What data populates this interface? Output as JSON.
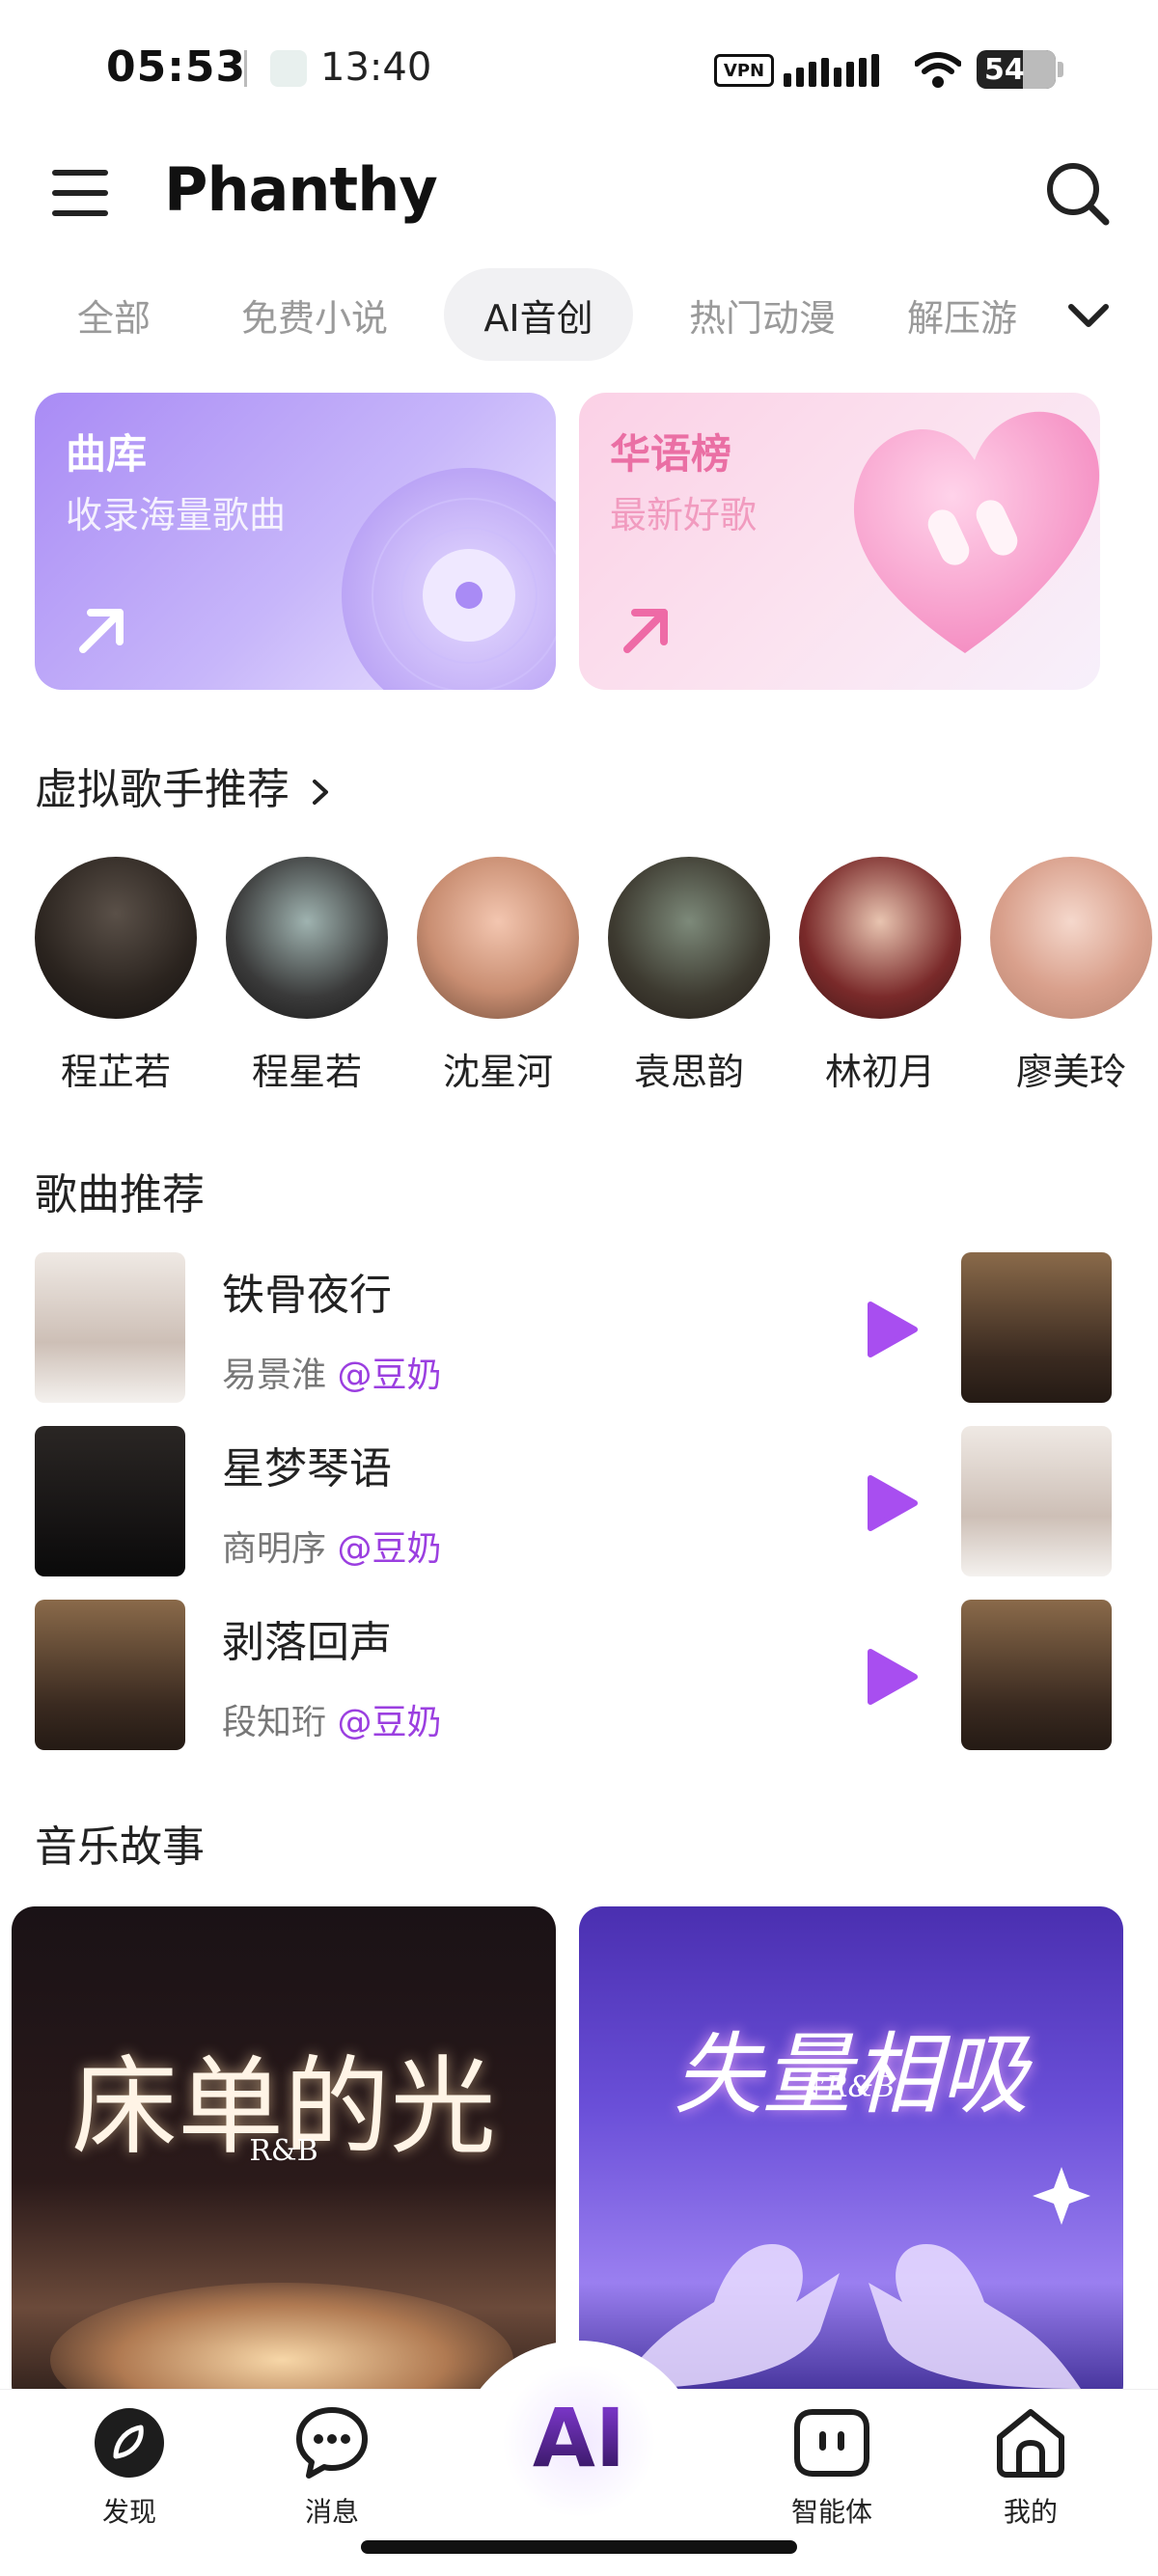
{
  "status_bar": {
    "time": "05:53",
    "secondary_time": "13:40",
    "vpn": "VPN",
    "battery": "54"
  },
  "header": {
    "title": "Phanthy"
  },
  "tabs": [
    {
      "label": "全部"
    },
    {
      "label": "免费小说"
    },
    {
      "label": "AI音创",
      "active": true
    },
    {
      "label": "热门动漫"
    },
    {
      "label": "解压游"
    }
  ],
  "feature_cards": [
    {
      "title": "曲库",
      "subtitle": "收录海量歌曲"
    },
    {
      "title": "华语榜",
      "subtitle": "最新好歌"
    }
  ],
  "sections": {
    "singers": "虚拟歌手推荐",
    "songs": "歌曲推荐",
    "stories": "音乐故事"
  },
  "singers": [
    {
      "name": "程芷若"
    },
    {
      "name": "程星若"
    },
    {
      "name": "沈星河"
    },
    {
      "name": "袁思韵"
    },
    {
      "name": "林初月"
    },
    {
      "name": "廖美玲"
    }
  ],
  "songs": [
    {
      "title": "铁骨夜行",
      "artist": "易景淮",
      "tag": "@豆奶"
    },
    {
      "title": "星梦琴语",
      "artist": "商明序",
      "tag": "@豆奶"
    },
    {
      "title": "剥落回声",
      "artist": "段知珩",
      "tag": "@豆奶"
    }
  ],
  "stories": [
    {
      "title": "床单的光",
      "subtitle": "R&B"
    },
    {
      "title": "失量相吸",
      "subtitle": "♪R&B"
    }
  ],
  "bottom_nav": {
    "discover": "发现",
    "messages": "消息",
    "ai": "AI",
    "agents": "智能体",
    "me": "我的"
  },
  "colors": {
    "accent": "#9b3fe0",
    "play": "#a84ef0"
  }
}
